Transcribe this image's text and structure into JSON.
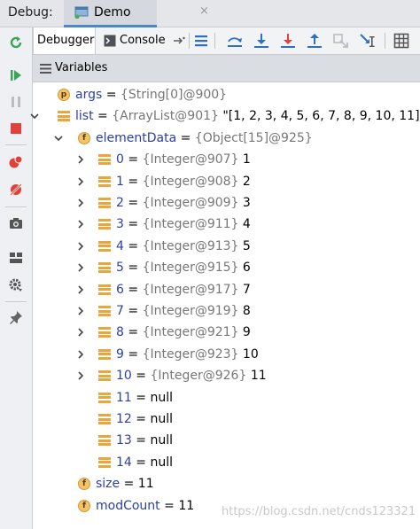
{
  "window": {
    "label": "Debug:",
    "tab_name": "Demo",
    "tab_close": "×"
  },
  "toolbar": {
    "debugger_tab": "Debugger",
    "console_tab": "Console"
  },
  "variables_panel": {
    "title": "Variables"
  },
  "tree": [
    {
      "depth": 0,
      "expand": "none",
      "icon": "p",
      "name": "args",
      "eq": " = ",
      "type": "{String[0]@900}",
      "value": ""
    },
    {
      "depth": 0,
      "expand": "open",
      "icon": "list",
      "name": "list",
      "eq": " = ",
      "type": "{ArrayList@901}",
      "value": " \"[1, 2, 3, 4, 5, 6, 7, 8, 9, 10, 11]\""
    },
    {
      "depth": 1,
      "expand": "open",
      "icon": "f",
      "name": "elementData",
      "eq": " = ",
      "type": "{Object[15]@925}",
      "value": ""
    },
    {
      "depth": 2,
      "expand": "closed",
      "icon": "list",
      "name": "0",
      "eq": " = ",
      "type": "{Integer@907}",
      "value": " 1"
    },
    {
      "depth": 2,
      "expand": "closed",
      "icon": "list",
      "name": "1",
      "eq": " = ",
      "type": "{Integer@908}",
      "value": " 2"
    },
    {
      "depth": 2,
      "expand": "closed",
      "icon": "list",
      "name": "2",
      "eq": " = ",
      "type": "{Integer@909}",
      "value": " 3"
    },
    {
      "depth": 2,
      "expand": "closed",
      "icon": "list",
      "name": "3",
      "eq": " = ",
      "type": "{Integer@911}",
      "value": " 4"
    },
    {
      "depth": 2,
      "expand": "closed",
      "icon": "list",
      "name": "4",
      "eq": " = ",
      "type": "{Integer@913}",
      "value": " 5"
    },
    {
      "depth": 2,
      "expand": "closed",
      "icon": "list",
      "name": "5",
      "eq": " = ",
      "type": "{Integer@915}",
      "value": " 6"
    },
    {
      "depth": 2,
      "expand": "closed",
      "icon": "list",
      "name": "6",
      "eq": " = ",
      "type": "{Integer@917}",
      "value": " 7"
    },
    {
      "depth": 2,
      "expand": "closed",
      "icon": "list",
      "name": "7",
      "eq": " = ",
      "type": "{Integer@919}",
      "value": " 8"
    },
    {
      "depth": 2,
      "expand": "closed",
      "icon": "list",
      "name": "8",
      "eq": " = ",
      "type": "{Integer@921}",
      "value": " 9"
    },
    {
      "depth": 2,
      "expand": "closed",
      "icon": "list",
      "name": "9",
      "eq": " = ",
      "type": "{Integer@923}",
      "value": " 10"
    },
    {
      "depth": 2,
      "expand": "closed",
      "icon": "list",
      "name": "10",
      "eq": " = ",
      "type": "{Integer@926}",
      "value": " 11"
    },
    {
      "depth": 2,
      "expand": "none",
      "icon": "list",
      "name": "11",
      "eq": " = ",
      "type": "",
      "value": "null"
    },
    {
      "depth": 2,
      "expand": "none",
      "icon": "list",
      "name": "12",
      "eq": " = ",
      "type": "",
      "value": "null"
    },
    {
      "depth": 2,
      "expand": "none",
      "icon": "list",
      "name": "13",
      "eq": " = ",
      "type": "",
      "value": "null"
    },
    {
      "depth": 2,
      "expand": "none",
      "icon": "list",
      "name": "14",
      "eq": " = ",
      "type": "",
      "value": "null"
    },
    {
      "depth": 1,
      "expand": "none",
      "icon": "f",
      "name": "size",
      "eq": " = ",
      "type": "",
      "value": "11"
    },
    {
      "depth": 1,
      "expand": "none",
      "icon": "f",
      "name": "modCount",
      "eq": " = ",
      "type": "",
      "value": "11"
    }
  ],
  "watermark": "https://blog.csdn.net/cnds123321",
  "colors": {
    "accent": "#4a88c7",
    "var_name": "#2c3fa6",
    "type_text": "#777777",
    "icon_orange": "#e9a73b",
    "icon_field": "#f3c36b"
  }
}
